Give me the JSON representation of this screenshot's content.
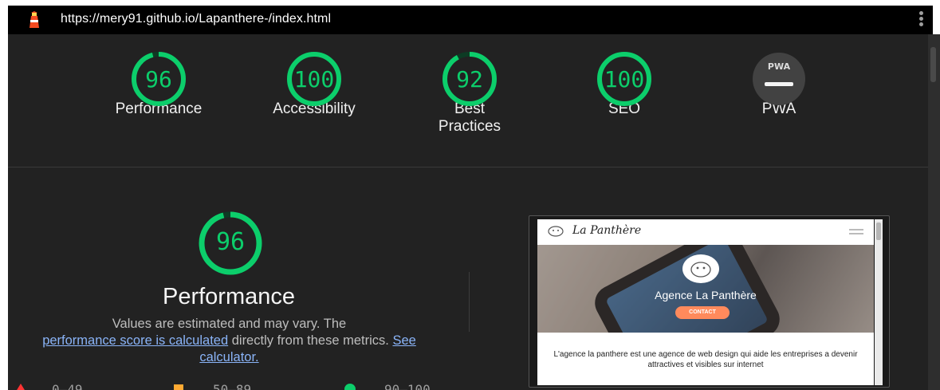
{
  "browser": {
    "url": "https://mery91.github.io/Lapanthere-/index.html"
  },
  "categories": [
    {
      "label": "Performance",
      "score": "96",
      "fraction": 0.96
    },
    {
      "label": "Accessibility",
      "score": "100",
      "fraction": 1.0
    },
    {
      "label": "Best Practices",
      "score": "92",
      "fraction": 0.92
    },
    {
      "label": "SEO",
      "score": "100",
      "fraction": 1.0
    }
  ],
  "pwa": {
    "label": "PWA",
    "badge": "PWA"
  },
  "performance": {
    "score": "96",
    "fraction": 0.96,
    "title": "Performance",
    "desc_start": "Values are estimated and may vary. The",
    "link_score": "performance score is calculated",
    "desc_mid": " directly from these metrics.",
    "link_calc": "See calculator."
  },
  "legend": {
    "fail": "0–49",
    "average": "50–89",
    "pass": "90–100"
  },
  "colors": {
    "pass": "#0cce6b",
    "average": "#ffaa33",
    "fail": "#ff3333",
    "background": "#222222"
  },
  "screenshot": {
    "site_name": "La Panthère",
    "hero_title": "Agence La Panthère",
    "hero_button": "CONTACT",
    "body_text": "L'agence la panthere est une agence de web design qui aide les entreprises a devenir attractives et visibles sur internet"
  }
}
